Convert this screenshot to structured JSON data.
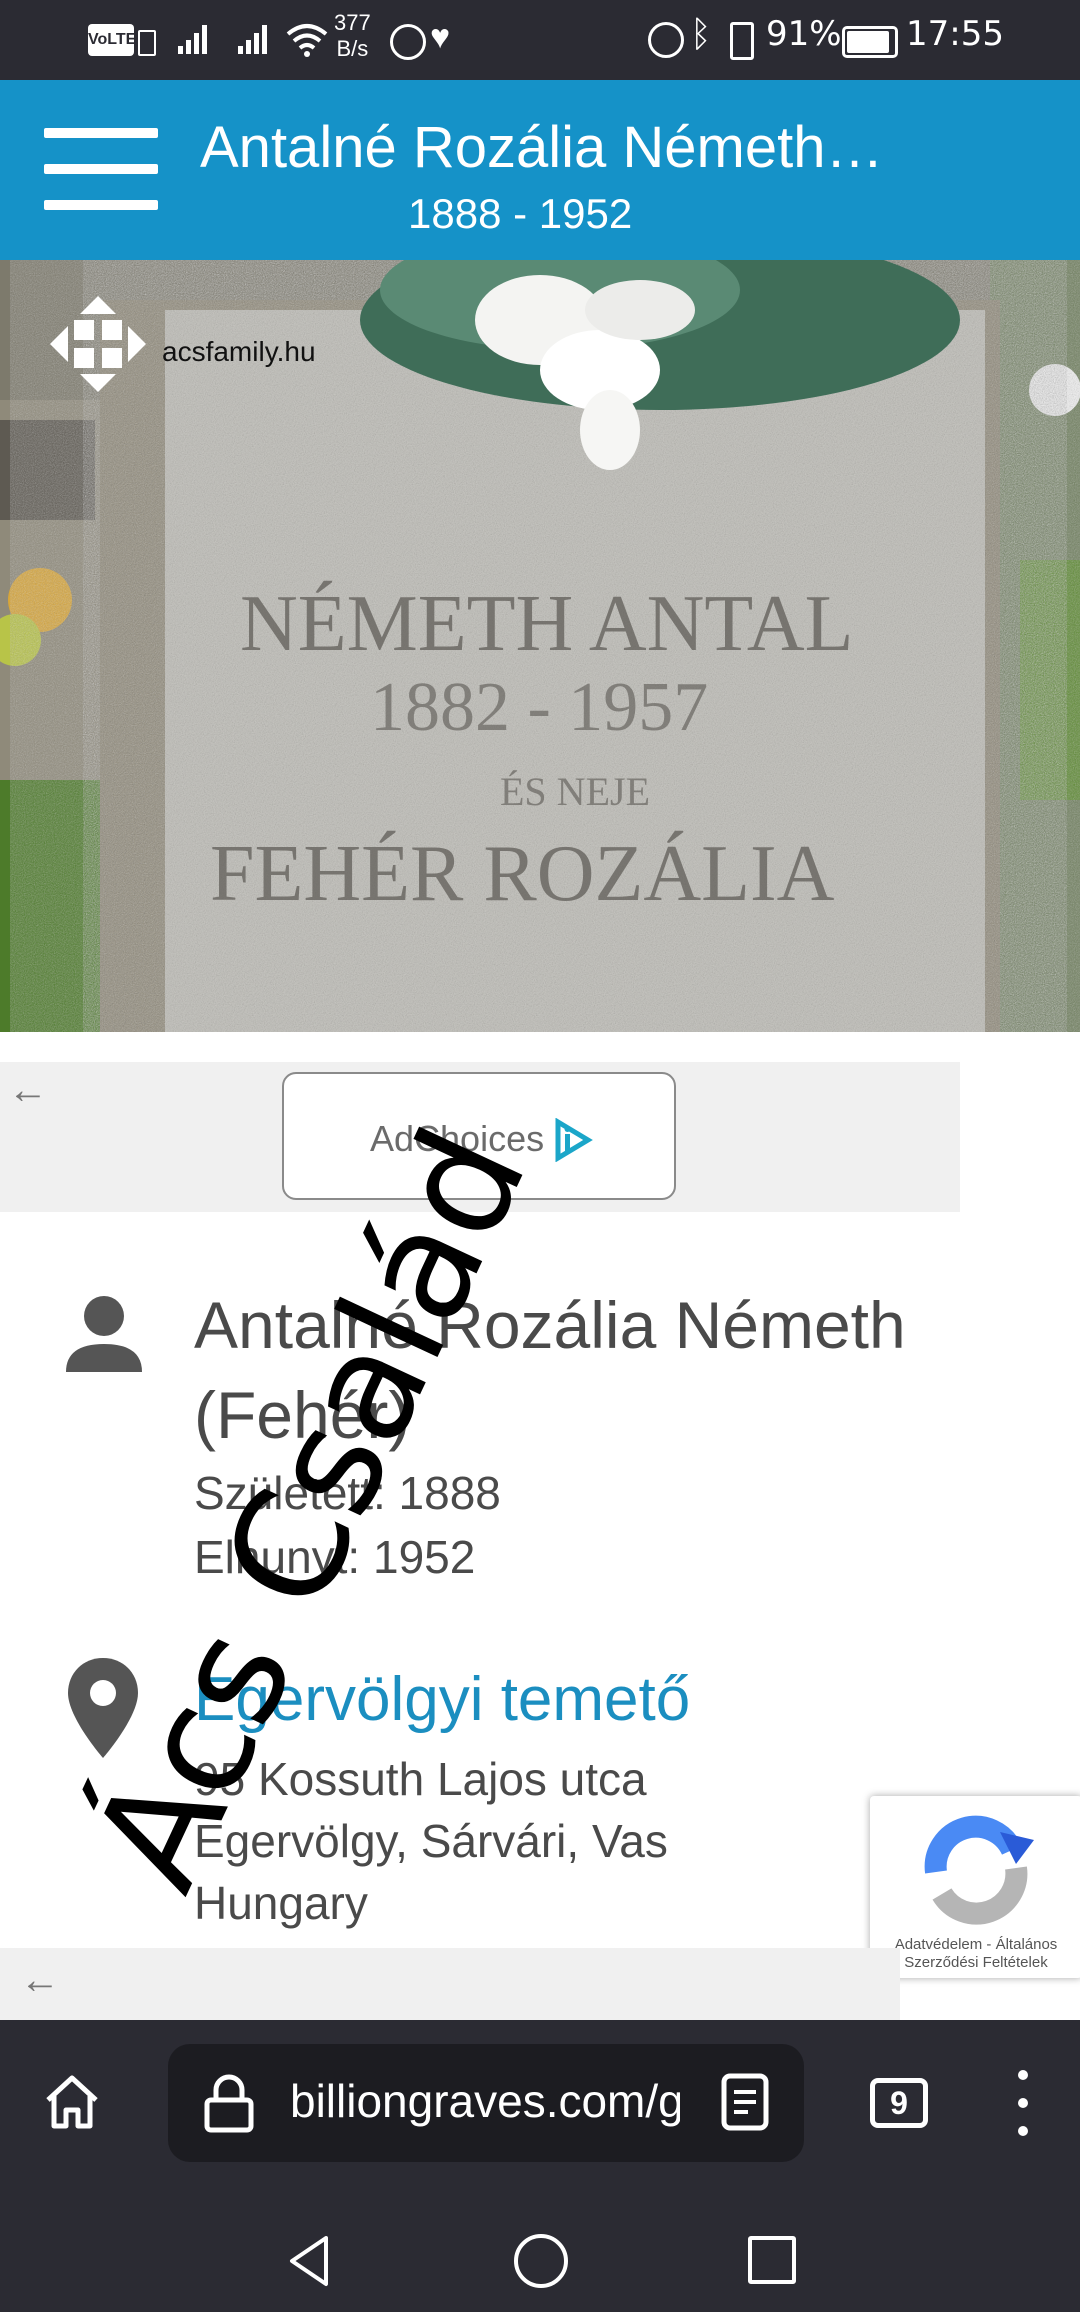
{
  "status_bar": {
    "network_speed_value": "377",
    "network_speed_unit": "B/s",
    "volte": "VoLTE",
    "battery": "91%",
    "time": "17:55"
  },
  "header": {
    "title": "Antalné Rozália Németh…",
    "dates": "1888 - 1952"
  },
  "photo": {
    "watermark_text": "acsfamily.hu"
  },
  "ad": {
    "label": "AdChoices"
  },
  "person": {
    "name_line1": "Antalné Rozália Németh",
    "name_line2": "(Fehér)",
    "born": "Született: 1888",
    "died": "Elhunyt: 1952"
  },
  "location": {
    "cemetery": "Egervölgyi temető",
    "address_line1": "95 Kossuth Lajos utca",
    "address_line2": "Egervölgy, Sárvári, Vas",
    "address_line3": "Hungary"
  },
  "overlay": {
    "watermark": "Ács Család"
  },
  "recaptcha": {
    "privacy": "Adatvédelem",
    "separator": "-",
    "terms_line1": "Általános",
    "terms_line2": "Szerződési Feltételek"
  },
  "browser": {
    "url": "billiongraves.com/g",
    "tab_count": "9"
  },
  "colors": {
    "header_blue": "#1592c8",
    "link_blue": "#1b8ec0",
    "system_bar": "#2b2b33"
  }
}
